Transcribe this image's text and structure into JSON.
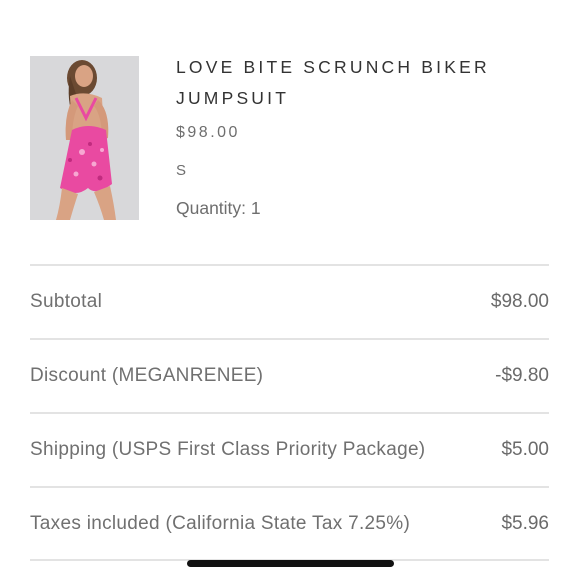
{
  "product": {
    "title": "LOVE BITE SCRUNCH BIKER JUMPSUIT",
    "price": "$98.00",
    "size": "S",
    "quantity": "Quantity: 1"
  },
  "summary": {
    "rows": [
      {
        "label": "Subtotal",
        "value": "$98.00"
      },
      {
        "label": "Discount (MEGANRENEE)",
        "value": "-$9.80"
      },
      {
        "label": "Shipping (USPS First Class Priority Package)",
        "value": "$5.00"
      },
      {
        "label": "Taxes included (California State Tax 7.25%)",
        "value": "$5.96"
      }
    ]
  },
  "colors": {
    "accent_pink": "#e94aa1",
    "divider": "#e3e3e3",
    "text": "#6b6b6b"
  }
}
